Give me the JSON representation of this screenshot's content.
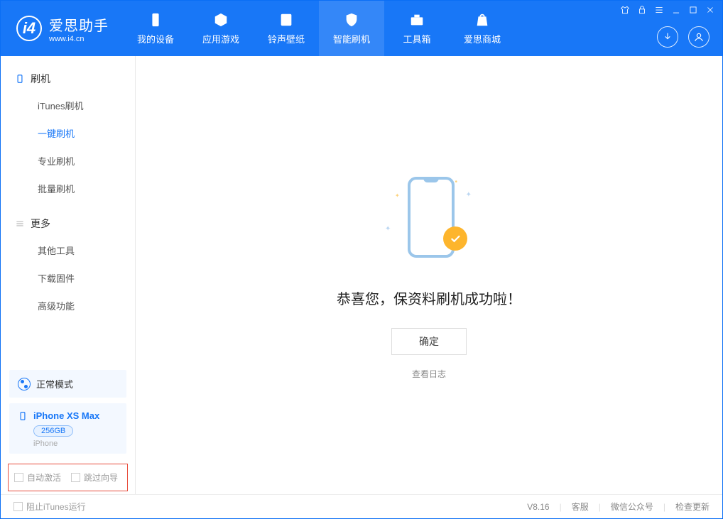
{
  "app": {
    "name": "爱思助手",
    "url": "www.i4.cn"
  },
  "nav": {
    "items": [
      {
        "label": "我的设备"
      },
      {
        "label": "应用游戏"
      },
      {
        "label": "铃声壁纸"
      },
      {
        "label": "智能刷机"
      },
      {
        "label": "工具箱"
      },
      {
        "label": "爱思商城"
      }
    ]
  },
  "sidebar": {
    "section1_title": "刷机",
    "section1": [
      "iTunes刷机",
      "一键刷机",
      "专业刷机",
      "批量刷机"
    ],
    "section2_title": "更多",
    "section2": [
      "其他工具",
      "下载固件",
      "高级功能"
    ],
    "mode": "正常模式",
    "device": {
      "name": "iPhone XS Max",
      "capacity": "256GB",
      "type": "iPhone"
    },
    "opt1": "自动激活",
    "opt2": "跳过向导"
  },
  "main": {
    "success": "恭喜您，保资料刷机成功啦！",
    "ok": "确定",
    "view_log": "查看日志"
  },
  "footer": {
    "block_itunes": "阻止iTunes运行",
    "version": "V8.16",
    "links": [
      "客服",
      "微信公众号",
      "检查更新"
    ]
  }
}
